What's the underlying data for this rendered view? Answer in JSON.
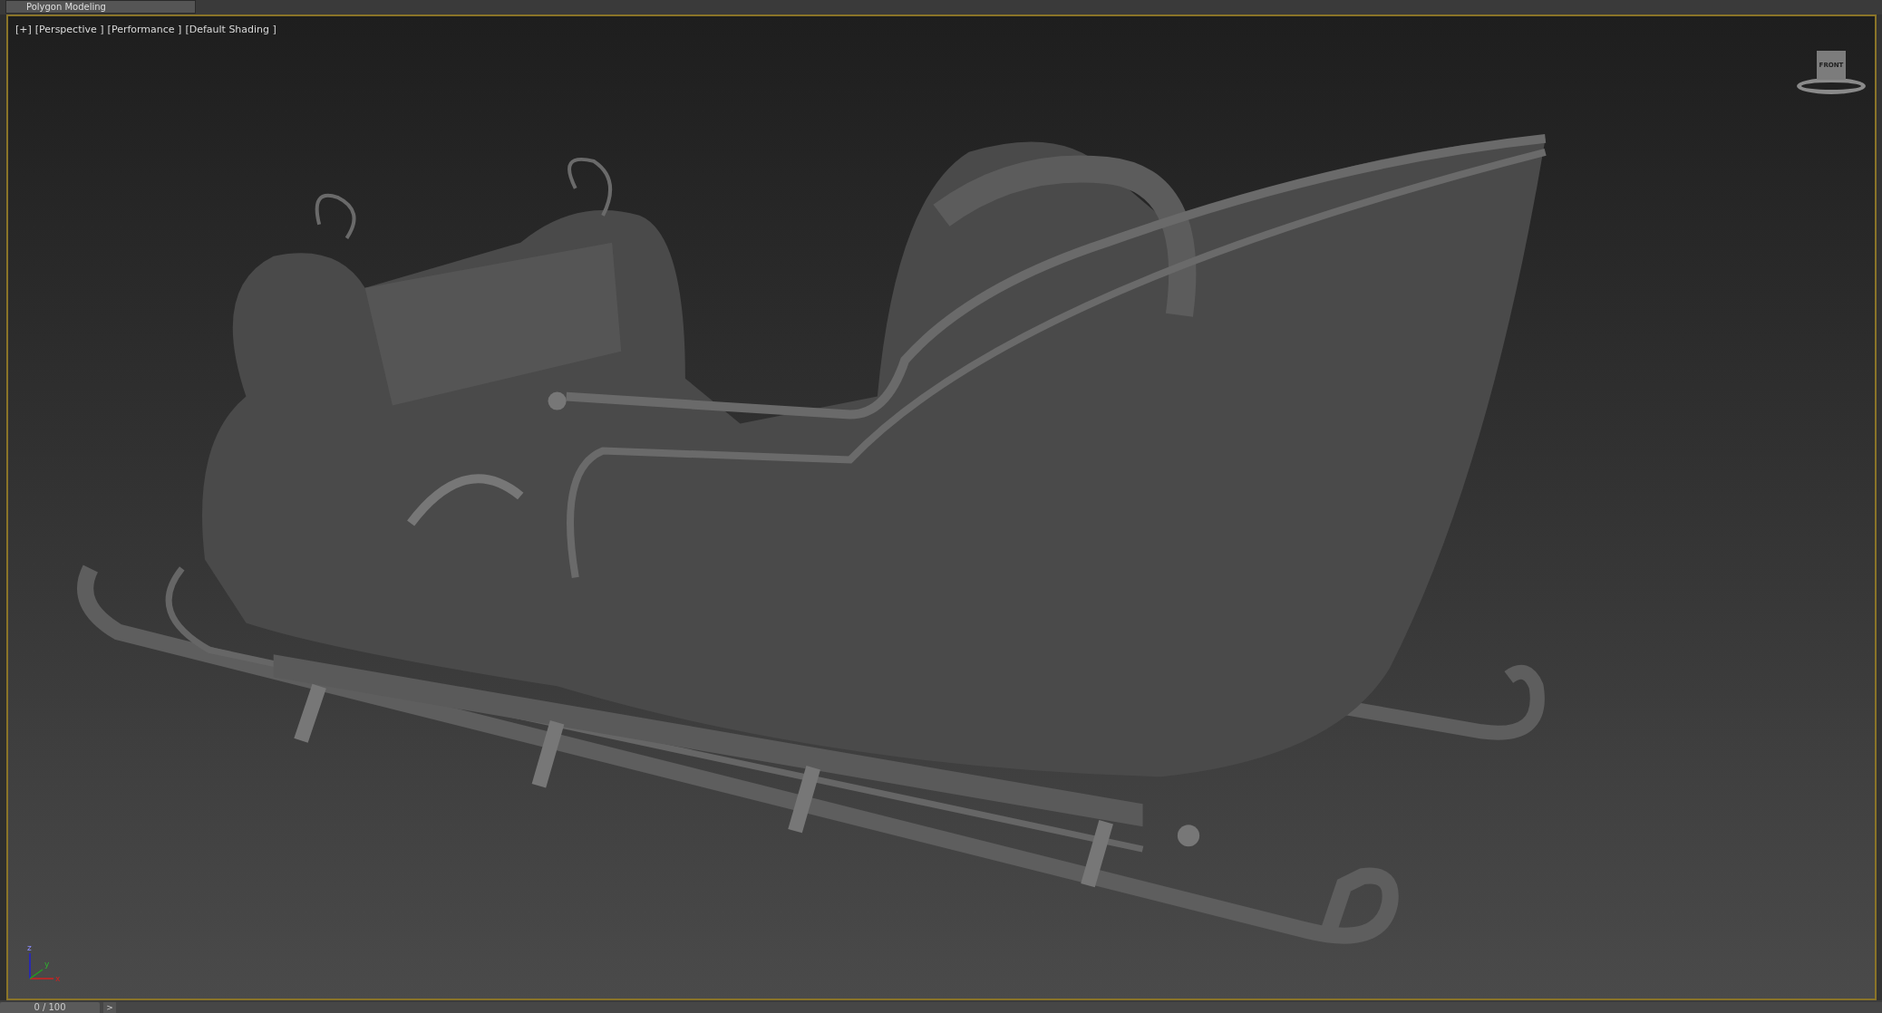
{
  "ribbon": {
    "tab_label": "Polygon Modeling"
  },
  "viewport": {
    "labels": [
      "[+]",
      "[Perspective ]",
      "[Performance ]",
      "[Default Shading ]"
    ],
    "viewcube": {
      "face_label": "FRONT"
    },
    "axis_tripod": {
      "x": "x",
      "y": "y",
      "z": "z"
    }
  },
  "time_slider": {
    "reading": "0 / 100",
    "level": 0,
    "next_button": ">"
  }
}
